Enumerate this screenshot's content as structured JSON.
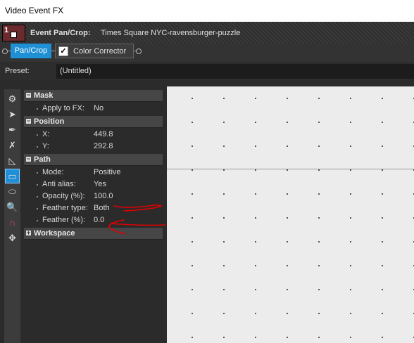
{
  "window": {
    "title": "Video Event FX"
  },
  "event": {
    "number": "1",
    "label": "Event Pan/Crop:",
    "name": "Times Square NYC-ravensburger-puzzle"
  },
  "chain": {
    "pan_crop_tab": "Pan/Crop",
    "color_corrector_tab": "Color Corrector",
    "color_corrector_checked": "✓"
  },
  "preset": {
    "label": "Preset:",
    "value": "(Untitled)"
  },
  "toolbar": {
    "tools": [
      "gear-icon",
      "arrow-icon",
      "pen-icon",
      "pen-remove-icon",
      "anchor-icon",
      "rectangle-icon",
      "ellipse-icon",
      "zoom-icon",
      "magnet-icon",
      "move-icon"
    ],
    "active": "rectangle-icon"
  },
  "sections": {
    "mask": {
      "title": "Mask",
      "expander": "−"
    },
    "position": {
      "title": "Position",
      "expander": "−"
    },
    "path": {
      "title": "Path",
      "expander": "−"
    },
    "workspace": {
      "title": "Workspace",
      "expander": "+"
    }
  },
  "props": {
    "apply_to_fx": {
      "name": "Apply to FX:",
      "value": "No"
    },
    "x": {
      "name": "X:",
      "value": "449.8"
    },
    "y": {
      "name": "Y:",
      "value": "292.8"
    },
    "mode": {
      "name": "Mode:",
      "value": "Positive"
    },
    "anti_alias": {
      "name": "Anti alias:",
      "value": "Yes"
    },
    "opacity": {
      "name": "Opacity (%):",
      "value": "100.0"
    },
    "feather_type": {
      "name": "Feather type:",
      "value": "Both"
    },
    "feather": {
      "name": "Feather (%):",
      "value": "0.0"
    }
  },
  "colors": {
    "accent": "#1f8fd6",
    "event_bg": "#6b2a2e",
    "annotation": "#e00000"
  }
}
